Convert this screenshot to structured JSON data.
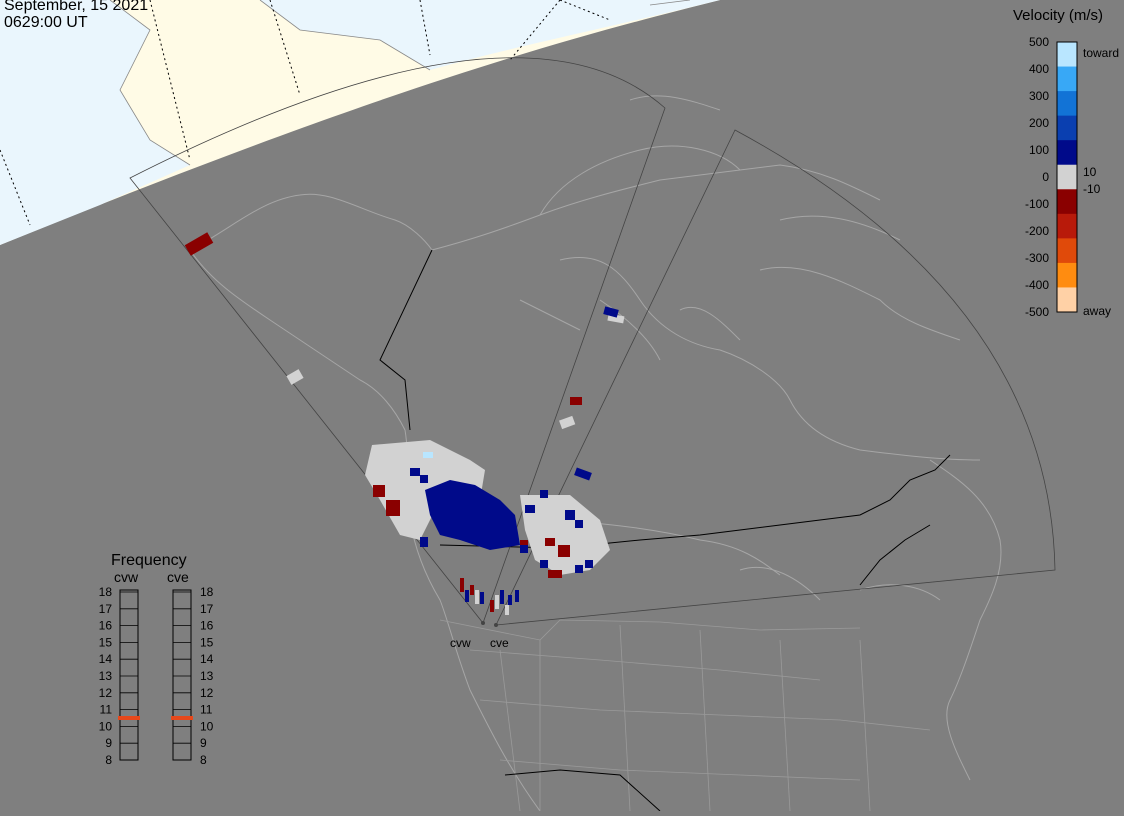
{
  "header": {
    "date": "September, 15 2021",
    "time": "0629:00 UT"
  },
  "colors": {
    "background": "#7f7f7f",
    "daylight": "#fffbe6",
    "ocean_day": "#eaf6fd",
    "coast": "#a6a6a6",
    "ground_scatter": "#d2d2d2"
  },
  "velocity_scale": {
    "title": "Velocity (m/s)",
    "ticks": [
      "500",
      "400",
      "300",
      "200",
      "100",
      "0",
      "-100",
      "-200",
      "-300",
      "-400",
      "-500"
    ],
    "small_labels": [
      "10",
      "-10"
    ],
    "toward_label": "toward",
    "away_label": "away",
    "colors": [
      "#b9e6ff",
      "#38a8f6",
      "#1273d6",
      "#0a3fb0",
      "#000a8a",
      "#d2d2d2",
      "#8a0000",
      "#b81a0a",
      "#e04a0a",
      "#ff8c10",
      "#ffd1a6"
    ]
  },
  "frequency": {
    "title": "Frequency",
    "radars": [
      "cvw",
      "cve"
    ],
    "ticks": [
      "18",
      "17",
      "16",
      "15",
      "14",
      "13",
      "12",
      "11",
      "10",
      "9",
      "8"
    ],
    "cvw_mhz": 10.5,
    "cve_mhz": 10.5,
    "marker_color": "#e8481a"
  },
  "radars": [
    {
      "name": "cvw",
      "icon": "radar-site-icon"
    },
    {
      "name": "cve",
      "icon": "radar-site-icon"
    }
  ]
}
